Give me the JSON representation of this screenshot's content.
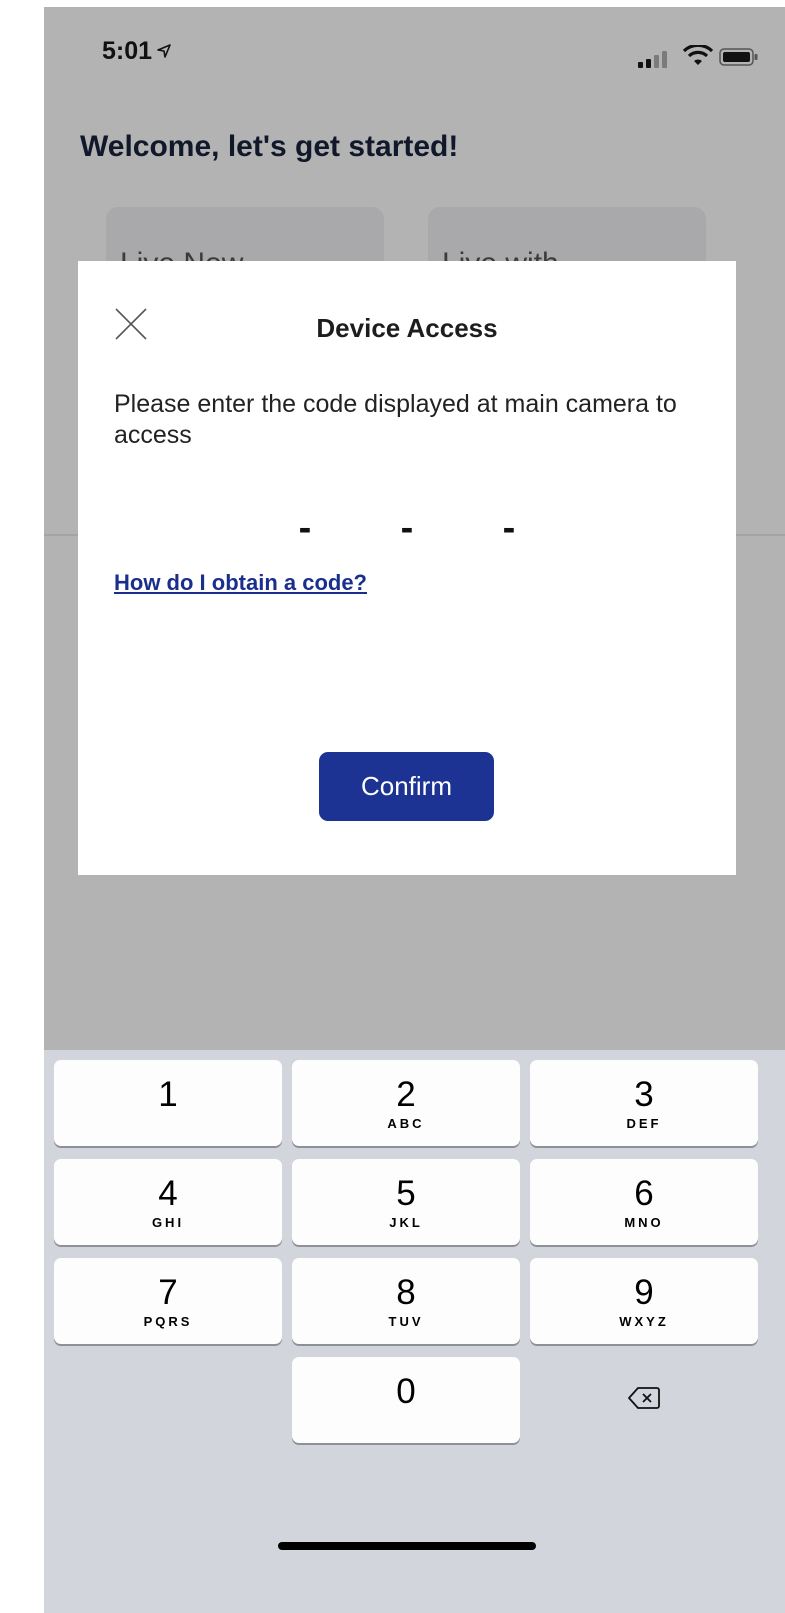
{
  "status_bar": {
    "time": "5:01",
    "location_icon": "location-arrow-icon",
    "signal_bars": 2,
    "wifi_icon": "wifi-icon",
    "battery_icon": "battery-icon"
  },
  "screen": {
    "welcome": "Welcome, let's get started!",
    "cards": [
      "Live Now",
      "Live with"
    ]
  },
  "dialog": {
    "title": "Device Access",
    "close_icon": "close-icon",
    "message": "Please enter the code displayed at main camera to access",
    "code_slots": [
      "-",
      "-",
      "-"
    ],
    "help_link": "How do I obtain a code?",
    "confirm_label": "Confirm",
    "confirm_color": "#1c3393"
  },
  "keypad": {
    "keys": [
      {
        "digit": "1",
        "letters": ""
      },
      {
        "digit": "2",
        "letters": "ABC"
      },
      {
        "digit": "3",
        "letters": "DEF"
      },
      {
        "digit": "4",
        "letters": "GHI"
      },
      {
        "digit": "5",
        "letters": "JKL"
      },
      {
        "digit": "6",
        "letters": "MNO"
      },
      {
        "digit": "7",
        "letters": "PQRS"
      },
      {
        "digit": "8",
        "letters": "TUV"
      },
      {
        "digit": "9",
        "letters": "WXYZ"
      },
      {
        "digit": "0",
        "letters": ""
      }
    ],
    "delete_icon": "backspace-icon"
  }
}
